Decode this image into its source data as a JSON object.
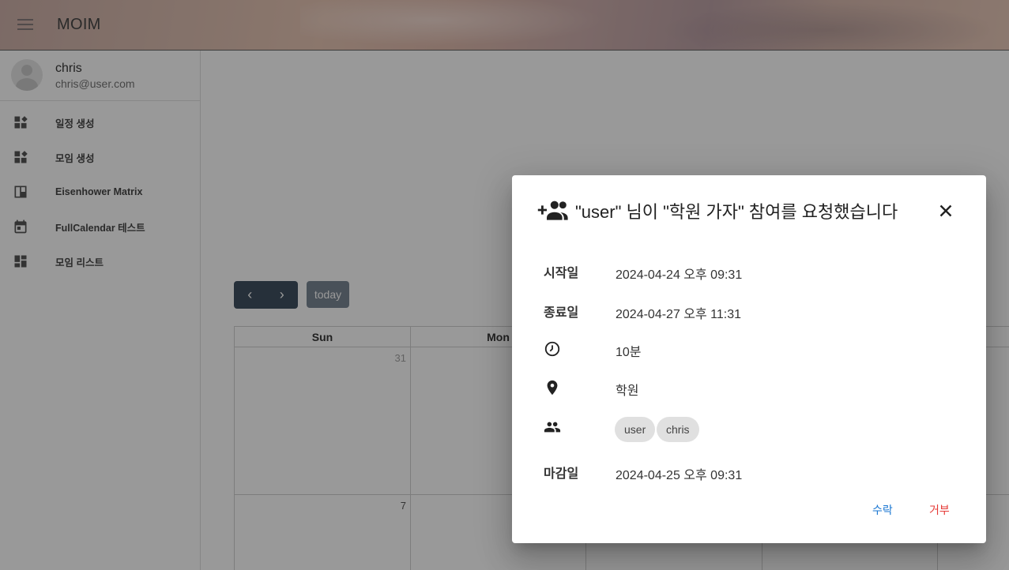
{
  "app": {
    "title": "MOIM"
  },
  "user": {
    "name": "chris",
    "email": "chris@user.com"
  },
  "sidebar": {
    "items": [
      {
        "label": "일정 생성",
        "icon": "dashboard-customize-icon"
      },
      {
        "label": "모임 생성",
        "icon": "dashboard-customize-icon"
      },
      {
        "label": "Eisenhower Matrix",
        "icon": "view-quilt-icon"
      },
      {
        "label": "FullCalendar 테스트",
        "icon": "calendar-icon"
      },
      {
        "label": "모임 리스트",
        "icon": "dashboard-icon"
      }
    ]
  },
  "calendar": {
    "prev_label": "‹",
    "next_label": "›",
    "today_label": "today",
    "day_headers": [
      "Sun",
      "Mon",
      "",
      "",
      ""
    ],
    "day_numbers": [
      "31",
      "7"
    ]
  },
  "dialog": {
    "title": "\"user\" 님이 \"학원 가자\" 참여를 요청했습니다",
    "rows": {
      "start_label": "시작일",
      "start_value": "2024-04-24 오후 09:31",
      "end_label": "종료일",
      "end_value": "2024-04-27 오후 11:31",
      "alarm_value": "10분",
      "location_value": "학원",
      "deadline_label": "마감일",
      "deadline_value": "2024-04-25 오후 09:31"
    },
    "participants": [
      "user",
      "chris"
    ],
    "accept_label": "수락",
    "reject_label": "거부"
  },
  "colors": {
    "accent": "#1976d2",
    "danger": "#e53935",
    "button_dark": "#2c3e50",
    "button_muted": "#6c7a89"
  }
}
